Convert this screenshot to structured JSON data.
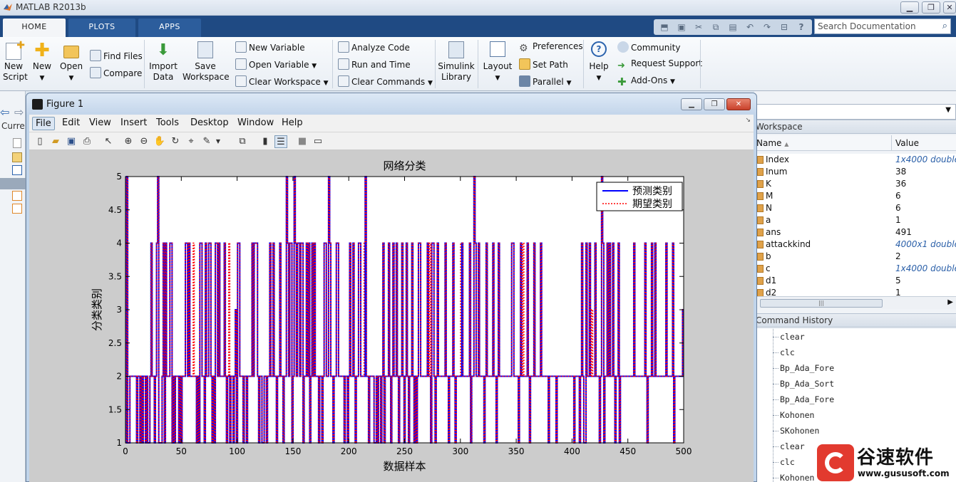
{
  "app": {
    "title": "MATLAB R2013b"
  },
  "ribbon_tabs": [
    "HOME",
    "PLOTS",
    "APPS"
  ],
  "search": {
    "placeholder": "Search Documentation"
  },
  "ribbon": {
    "new_script": "New Script",
    "new": "New",
    "open": "Open",
    "find_files": "Find Files",
    "compare": "Compare",
    "import_data": "Import Data",
    "save_workspace": "Save Workspace",
    "new_variable": "New Variable",
    "open_variable": "Open Variable",
    "clear_workspace": "Clear Workspace",
    "analyze_code": "Analyze Code",
    "run_and_time": "Run and Time",
    "clear_commands": "Clear Commands",
    "simulink_library": "Simulink Library",
    "layout": "Layout",
    "preferences": "Preferences",
    "set_path": "Set Path",
    "parallel": "Parallel",
    "help": "Help",
    "community": "Community",
    "request_support": "Request Support",
    "add_ons": "Add-Ons"
  },
  "left_panel": {
    "current_folder_label": "Curre"
  },
  "workspace": {
    "title": "Workspace",
    "col_name": "Name",
    "col_value": "Value",
    "rows": [
      {
        "name": "Index",
        "value": "1x4000 double",
        "italic": true
      },
      {
        "name": "Inum",
        "value": "38",
        "italic": false
      },
      {
        "name": "K",
        "value": "36",
        "italic": false
      },
      {
        "name": "M",
        "value": "6",
        "italic": false
      },
      {
        "name": "N",
        "value": "6",
        "italic": false
      },
      {
        "name": "a",
        "value": "1",
        "italic": false
      },
      {
        "name": "ans",
        "value": "491",
        "italic": false
      },
      {
        "name": "attackkind",
        "value": "4000x1 double",
        "italic": true
      },
      {
        "name": "b",
        "value": "2",
        "italic": false
      },
      {
        "name": "c",
        "value": "1x4000 double",
        "italic": true
      },
      {
        "name": "d1",
        "value": "5",
        "italic": false
      },
      {
        "name": "d2",
        "value": "1",
        "italic": false
      }
    ]
  },
  "command_history": {
    "title": "Command History",
    "items": [
      "clear",
      "clc",
      "Bp_Ada_Fore",
      "Bp_Ada_Sort",
      "Bp_Ada_Fore",
      "Kohonen",
      "SKohonen",
      "clear",
      "clc",
      "Kohonen"
    ]
  },
  "figure": {
    "title": "Figure 1",
    "menus": [
      "File",
      "Edit",
      "View",
      "Insert",
      "Tools",
      "Desktop",
      "Window",
      "Help"
    ]
  },
  "chart_data": {
    "type": "line",
    "title": "网络分类",
    "xlabel": "数据样本",
    "ylabel": "分类类别",
    "xlim": [
      0,
      500
    ],
    "ylim": [
      1,
      5
    ],
    "xticks": [
      0,
      50,
      100,
      150,
      200,
      250,
      300,
      350,
      400,
      450,
      500
    ],
    "yticks": [
      1,
      1.5,
      2,
      2.5,
      3,
      3.5,
      4,
      4.5,
      5
    ],
    "legend_position": "top-right",
    "colors": {
      "predicted": "#0000ff",
      "expected": "#ff0000"
    },
    "series": [
      {
        "name": "预测类别",
        "style": "solid",
        "values": [
          1,
          1,
          5,
          1,
          1,
          2,
          2,
          2,
          2,
          2,
          2,
          1,
          2,
          2,
          1,
          2,
          1,
          2,
          2,
          1,
          2,
          1,
          1,
          2,
          4,
          2,
          2,
          1,
          2,
          4,
          5,
          1,
          1,
          1,
          2,
          4,
          1,
          4,
          2,
          2,
          2,
          4,
          4,
          1,
          2,
          1,
          2,
          2,
          2,
          1,
          2,
          1,
          2,
          2,
          2,
          4,
          4,
          2,
          4,
          2,
          2,
          2,
          2,
          2,
          2,
          1,
          2,
          1,
          4,
          4,
          2,
          2,
          1,
          4,
          2,
          2,
          4,
          4,
          2,
          1,
          2,
          1,
          4,
          4,
          2,
          4,
          2,
          2,
          2,
          2,
          4,
          2,
          1,
          2,
          2,
          1,
          2,
          2,
          1,
          2,
          3,
          1,
          4,
          4,
          2,
          2,
          2,
          1,
          2,
          2,
          1,
          2,
          2,
          2,
          2,
          4,
          2,
          4,
          4,
          4,
          2,
          1,
          2,
          2,
          1,
          1,
          2,
          2,
          1,
          2,
          2,
          4,
          2,
          2,
          4,
          2,
          2,
          1,
          2,
          2,
          4,
          2,
          2,
          1,
          2,
          2,
          5,
          4,
          2,
          4,
          4,
          1,
          2,
          5,
          4,
          2,
          4,
          4,
          2,
          4,
          4,
          1,
          2,
          2,
          4,
          2,
          4,
          1,
          2,
          4,
          2,
          4,
          2,
          2,
          2,
          1,
          2,
          2,
          1,
          2,
          4,
          4,
          2,
          2,
          5,
          4,
          2,
          2,
          1,
          2,
          2,
          4,
          4,
          2,
          2,
          2,
          2,
          2,
          1,
          2,
          2,
          1,
          2,
          4,
          2,
          2,
          4,
          2,
          1,
          2,
          2,
          4,
          4,
          2,
          2,
          2,
          2,
          5,
          2,
          2,
          1,
          2,
          2,
          2,
          2,
          1,
          1,
          2,
          1,
          2,
          2,
          1,
          2,
          4,
          1,
          2,
          2,
          2,
          4,
          2,
          1,
          2,
          4,
          2,
          2,
          4,
          2,
          1,
          2,
          2,
          4,
          2,
          1,
          2,
          4,
          2,
          1,
          2,
          2,
          4,
          2,
          1,
          2,
          1,
          2,
          4,
          4,
          2,
          2,
          2,
          2,
          2,
          2,
          4,
          2,
          2,
          1,
          4,
          4,
          2,
          1,
          2,
          4,
          2,
          2,
          2,
          2,
          2,
          2,
          4,
          2,
          2,
          1,
          2,
          2,
          2,
          4,
          2,
          1,
          2,
          2,
          2,
          2,
          2,
          4,
          2,
          2,
          2,
          2,
          2,
          2,
          4,
          1,
          2,
          2,
          5,
          4,
          2,
          2,
          4,
          2,
          2,
          2,
          2,
          1,
          2,
          4,
          2,
          2,
          2,
          2,
          2,
          4,
          2,
          2,
          1,
          2,
          4,
          2,
          2,
          2,
          2,
          2,
          2,
          2,
          2,
          2,
          2,
          2,
          4,
          4,
          2,
          2,
          2,
          2,
          1,
          2,
          4,
          2,
          2,
          2,
          2,
          2,
          4,
          2,
          1,
          2,
          2,
          2,
          4,
          2,
          2,
          2,
          2,
          2,
          4,
          2,
          2,
          2,
          2,
          2,
          2,
          1,
          2,
          2,
          2,
          2,
          2,
          2,
          1,
          2,
          2,
          2,
          2,
          2,
          2,
          2,
          2,
          2,
          2,
          2,
          2,
          2,
          2,
          2,
          1,
          2,
          2,
          2,
          2,
          1,
          2,
          4,
          2,
          1,
          1,
          4,
          2,
          2,
          4,
          2,
          2,
          2,
          2,
          4,
          2,
          2,
          2,
          1,
          2,
          5,
          4,
          1,
          2,
          2,
          4,
          2,
          4,
          2,
          2,
          4,
          2,
          1,
          2,
          2,
          4,
          1,
          2,
          2,
          2,
          2,
          2,
          2,
          2,
          2,
          2,
          2,
          2,
          2,
          4,
          2,
          2,
          2,
          2,
          2,
          2,
          2,
          2,
          2,
          4,
          2,
          1,
          2,
          2,
          2,
          4,
          2,
          2,
          4,
          2,
          2,
          2,
          2,
          2,
          2,
          2,
          2,
          2,
          4,
          2,
          2,
          2,
          2,
          2,
          4,
          1,
          2,
          2,
          2,
          2,
          2,
          2,
          2,
          3
        ]
      },
      {
        "name": "期望类别",
        "style": "dotted",
        "values": [
          1,
          1,
          5,
          1,
          1,
          2,
          2,
          2,
          2,
          2,
          2,
          1,
          2,
          2,
          1,
          2,
          1,
          2,
          2,
          1,
          2,
          1,
          1,
          2,
          4,
          2,
          2,
          1,
          2,
          4,
          5,
          1,
          1,
          1,
          2,
          4,
          1,
          4,
          2,
          2,
          2,
          4,
          4,
          1,
          2,
          1,
          2,
          2,
          2,
          1,
          2,
          1,
          2,
          2,
          2,
          4,
          4,
          2,
          4,
          2,
          2,
          2,
          4,
          2,
          2,
          1,
          2,
          1,
          4,
          4,
          2,
          2,
          1,
          4,
          2,
          2,
          4,
          4,
          2,
          1,
          2,
          1,
          4,
          4,
          2,
          4,
          2,
          2,
          2,
          2,
          4,
          2,
          1,
          2,
          4,
          1,
          2,
          2,
          1,
          2,
          3,
          1,
          4,
          4,
          2,
          2,
          2,
          1,
          2,
          2,
          1,
          2,
          2,
          2,
          2,
          4,
          2,
          4,
          4,
          4,
          2,
          1,
          2,
          2,
          1,
          1,
          2,
          2,
          1,
          2,
          2,
          4,
          2,
          2,
          4,
          2,
          2,
          1,
          2,
          2,
          4,
          2,
          2,
          1,
          2,
          2,
          5,
          4,
          2,
          4,
          4,
          1,
          2,
          5,
          4,
          2,
          4,
          4,
          2,
          4,
          4,
          1,
          2,
          2,
          4,
          2,
          4,
          1,
          2,
          4,
          2,
          4,
          2,
          2,
          2,
          1,
          2,
          2,
          1,
          2,
          4,
          4,
          2,
          2,
          5,
          4,
          2,
          2,
          1,
          2,
          2,
          4,
          4,
          2,
          2,
          2,
          2,
          2,
          1,
          2,
          2,
          1,
          2,
          4,
          2,
          2,
          4,
          2,
          1,
          2,
          2,
          4,
          4,
          2,
          2,
          2,
          4,
          5,
          2,
          2,
          1,
          2,
          2,
          2,
          2,
          1,
          1,
          2,
          1,
          2,
          2,
          1,
          2,
          4,
          1,
          2,
          2,
          2,
          4,
          2,
          1,
          2,
          4,
          2,
          2,
          4,
          2,
          1,
          2,
          2,
          4,
          2,
          1,
          2,
          4,
          2,
          1,
          2,
          2,
          4,
          2,
          1,
          2,
          1,
          2,
          4,
          4,
          2,
          2,
          2,
          2,
          2,
          2,
          4,
          2,
          4,
          1,
          4,
          4,
          2,
          1,
          2,
          4,
          2,
          2,
          2,
          2,
          2,
          2,
          4,
          2,
          2,
          1,
          2,
          2,
          2,
          4,
          2,
          1,
          2,
          2,
          2,
          2,
          4,
          4,
          2,
          2,
          2,
          2,
          2,
          2,
          4,
          1,
          2,
          2,
          5,
          4,
          2,
          2,
          4,
          2,
          2,
          2,
          2,
          1,
          2,
          4,
          2,
          2,
          2,
          2,
          2,
          4,
          2,
          2,
          1,
          2,
          4,
          2,
          2,
          2,
          2,
          2,
          2,
          2,
          2,
          2,
          2,
          2,
          4,
          4,
          2,
          2,
          2,
          2,
          1,
          2,
          4,
          2,
          4,
          2,
          2,
          2,
          4,
          2,
          1,
          2,
          2,
          2,
          4,
          2,
          2,
          2,
          2,
          2,
          4,
          2,
          2,
          2,
          2,
          2,
          2,
          1,
          2,
          2,
          2,
          2,
          2,
          2,
          1,
          2,
          2,
          2,
          2,
          2,
          2,
          2,
          2,
          2,
          2,
          2,
          2,
          2,
          2,
          2,
          1,
          2,
          2,
          2,
          2,
          1,
          2,
          4,
          2,
          1,
          1,
          4,
          2,
          2,
          4,
          2,
          3,
          2,
          2,
          4,
          2,
          2,
          2,
          1,
          2,
          5,
          4,
          1,
          2,
          2,
          4,
          2,
          4,
          2,
          2,
          4,
          2,
          1,
          2,
          2,
          4,
          1,
          2,
          2,
          2,
          2,
          2,
          2,
          2,
          2,
          2,
          2,
          2,
          2,
          4,
          2,
          2,
          2,
          2,
          2,
          2,
          2,
          2,
          2,
          4,
          2,
          1,
          2,
          2,
          2,
          4,
          2,
          2,
          4,
          2,
          2,
          2,
          2,
          2,
          2,
          2,
          2,
          2,
          4,
          2,
          2,
          2,
          2,
          2,
          4,
          1,
          2,
          2,
          2,
          2,
          2,
          2,
          2,
          3
        ]
      }
    ]
  },
  "watermark": {
    "name": "谷速软件",
    "url": "www.gususoft.com"
  }
}
